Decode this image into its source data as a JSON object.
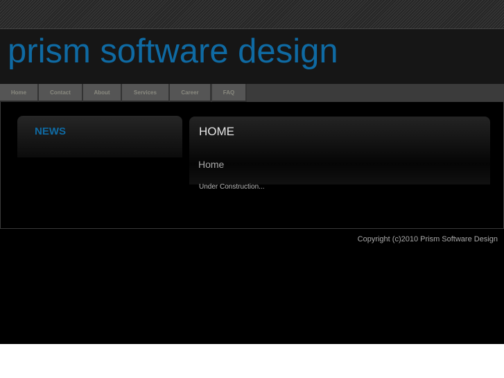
{
  "site": {
    "logo": "prism software design"
  },
  "nav": {
    "items": [
      "Home",
      "Contact",
      "About",
      "Services",
      "Career",
      "FAQ"
    ]
  },
  "sidebar": {
    "title": "NEWS"
  },
  "main": {
    "title": "HOME",
    "subtitle": "Home",
    "text": "Under Construction..."
  },
  "footer": {
    "copyright": "Copyright (c)2010 Prism Software Design"
  },
  "colors": {
    "brand": "#0f6aa3"
  }
}
